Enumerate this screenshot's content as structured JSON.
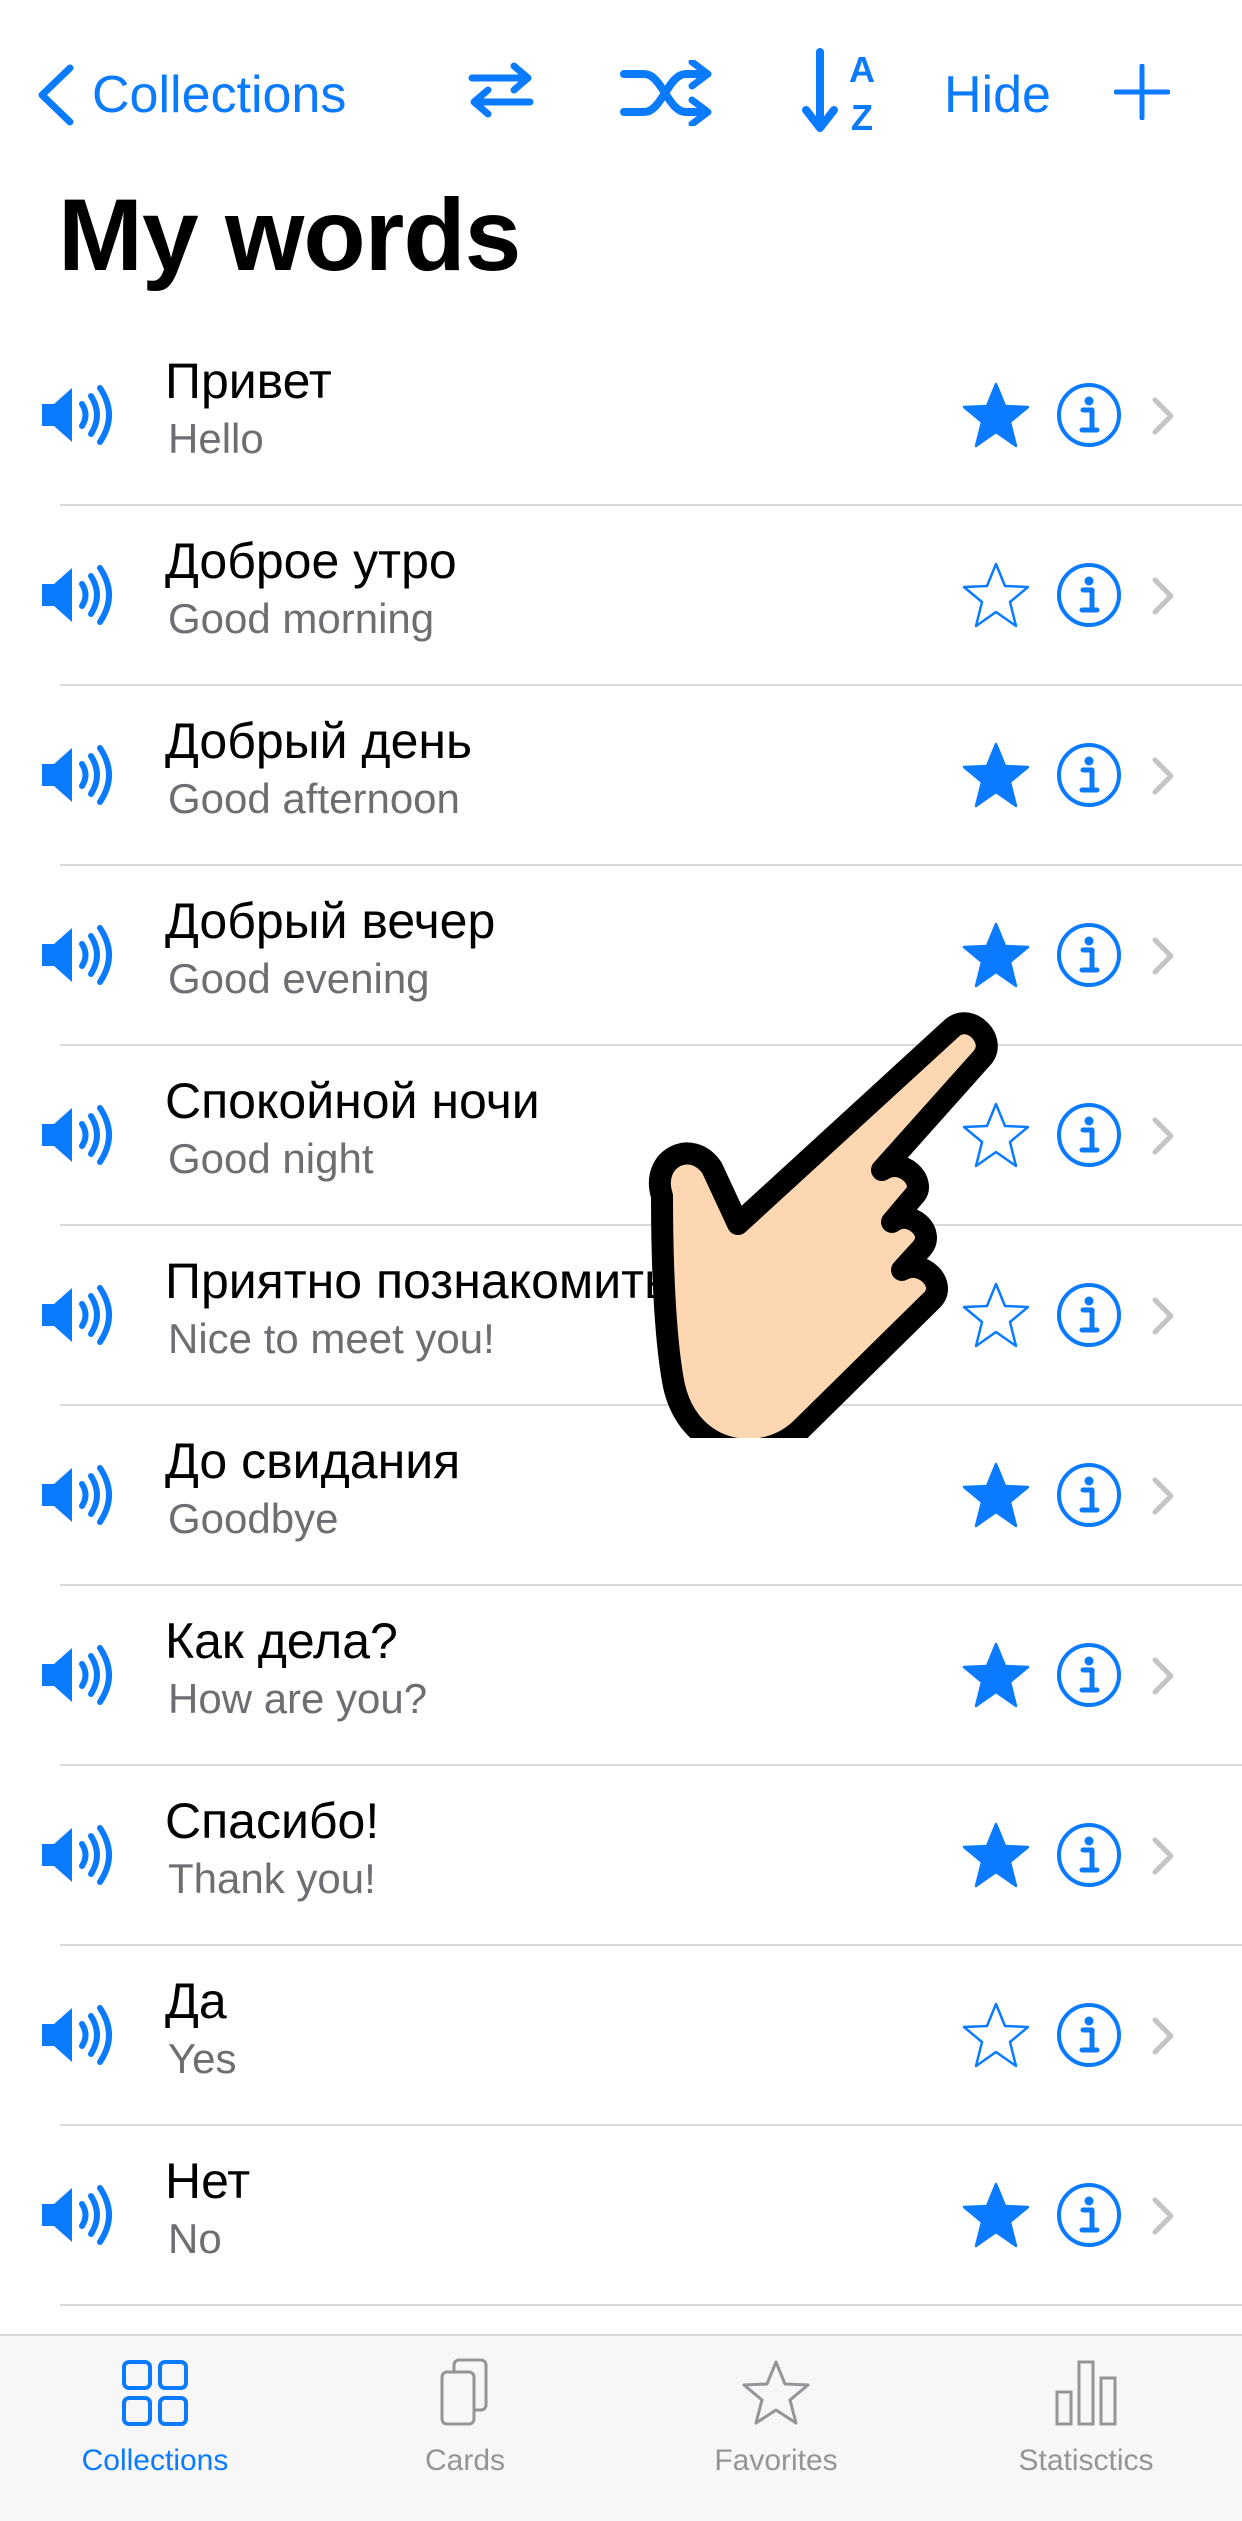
{
  "nav": {
    "back_label": "Collections",
    "hide_label": "Hide",
    "accent_color": "#0a7aff"
  },
  "page": {
    "title": "My words"
  },
  "words": [
    {
      "word": "Привет",
      "translation": "Hello",
      "favorite": true
    },
    {
      "word": "Доброе утро",
      "translation": "Good morning",
      "favorite": false
    },
    {
      "word": "Добрый день",
      "translation": "Good afternoon",
      "favorite": true
    },
    {
      "word": "Добрый вечер",
      "translation": "Good evening",
      "favorite": true
    },
    {
      "word": "Спокойной ночи",
      "translation": "Good night",
      "favorite": false
    },
    {
      "word": "Приятно познакомиться!",
      "translation": "Nice to meet you!",
      "favorite": false
    },
    {
      "word": "До свидания",
      "translation": "Goodbye",
      "favorite": true
    },
    {
      "word": "Как дела?",
      "translation": "How are you?",
      "favorite": true
    },
    {
      "word": "Спасибо!",
      "translation": "Thank you!",
      "favorite": true
    },
    {
      "word": "Да",
      "translation": "Yes",
      "favorite": false
    },
    {
      "word": "Нет",
      "translation": "No",
      "favorite": true
    }
  ],
  "tabs": [
    {
      "label": "Collections",
      "icon": "grid-icon",
      "active": true
    },
    {
      "label": "Cards",
      "icon": "cards-icon",
      "active": false
    },
    {
      "label": "Favorites",
      "icon": "star-icon",
      "active": false
    },
    {
      "label": "Statisctics",
      "icon": "bar-chart-icon",
      "active": false
    }
  ]
}
